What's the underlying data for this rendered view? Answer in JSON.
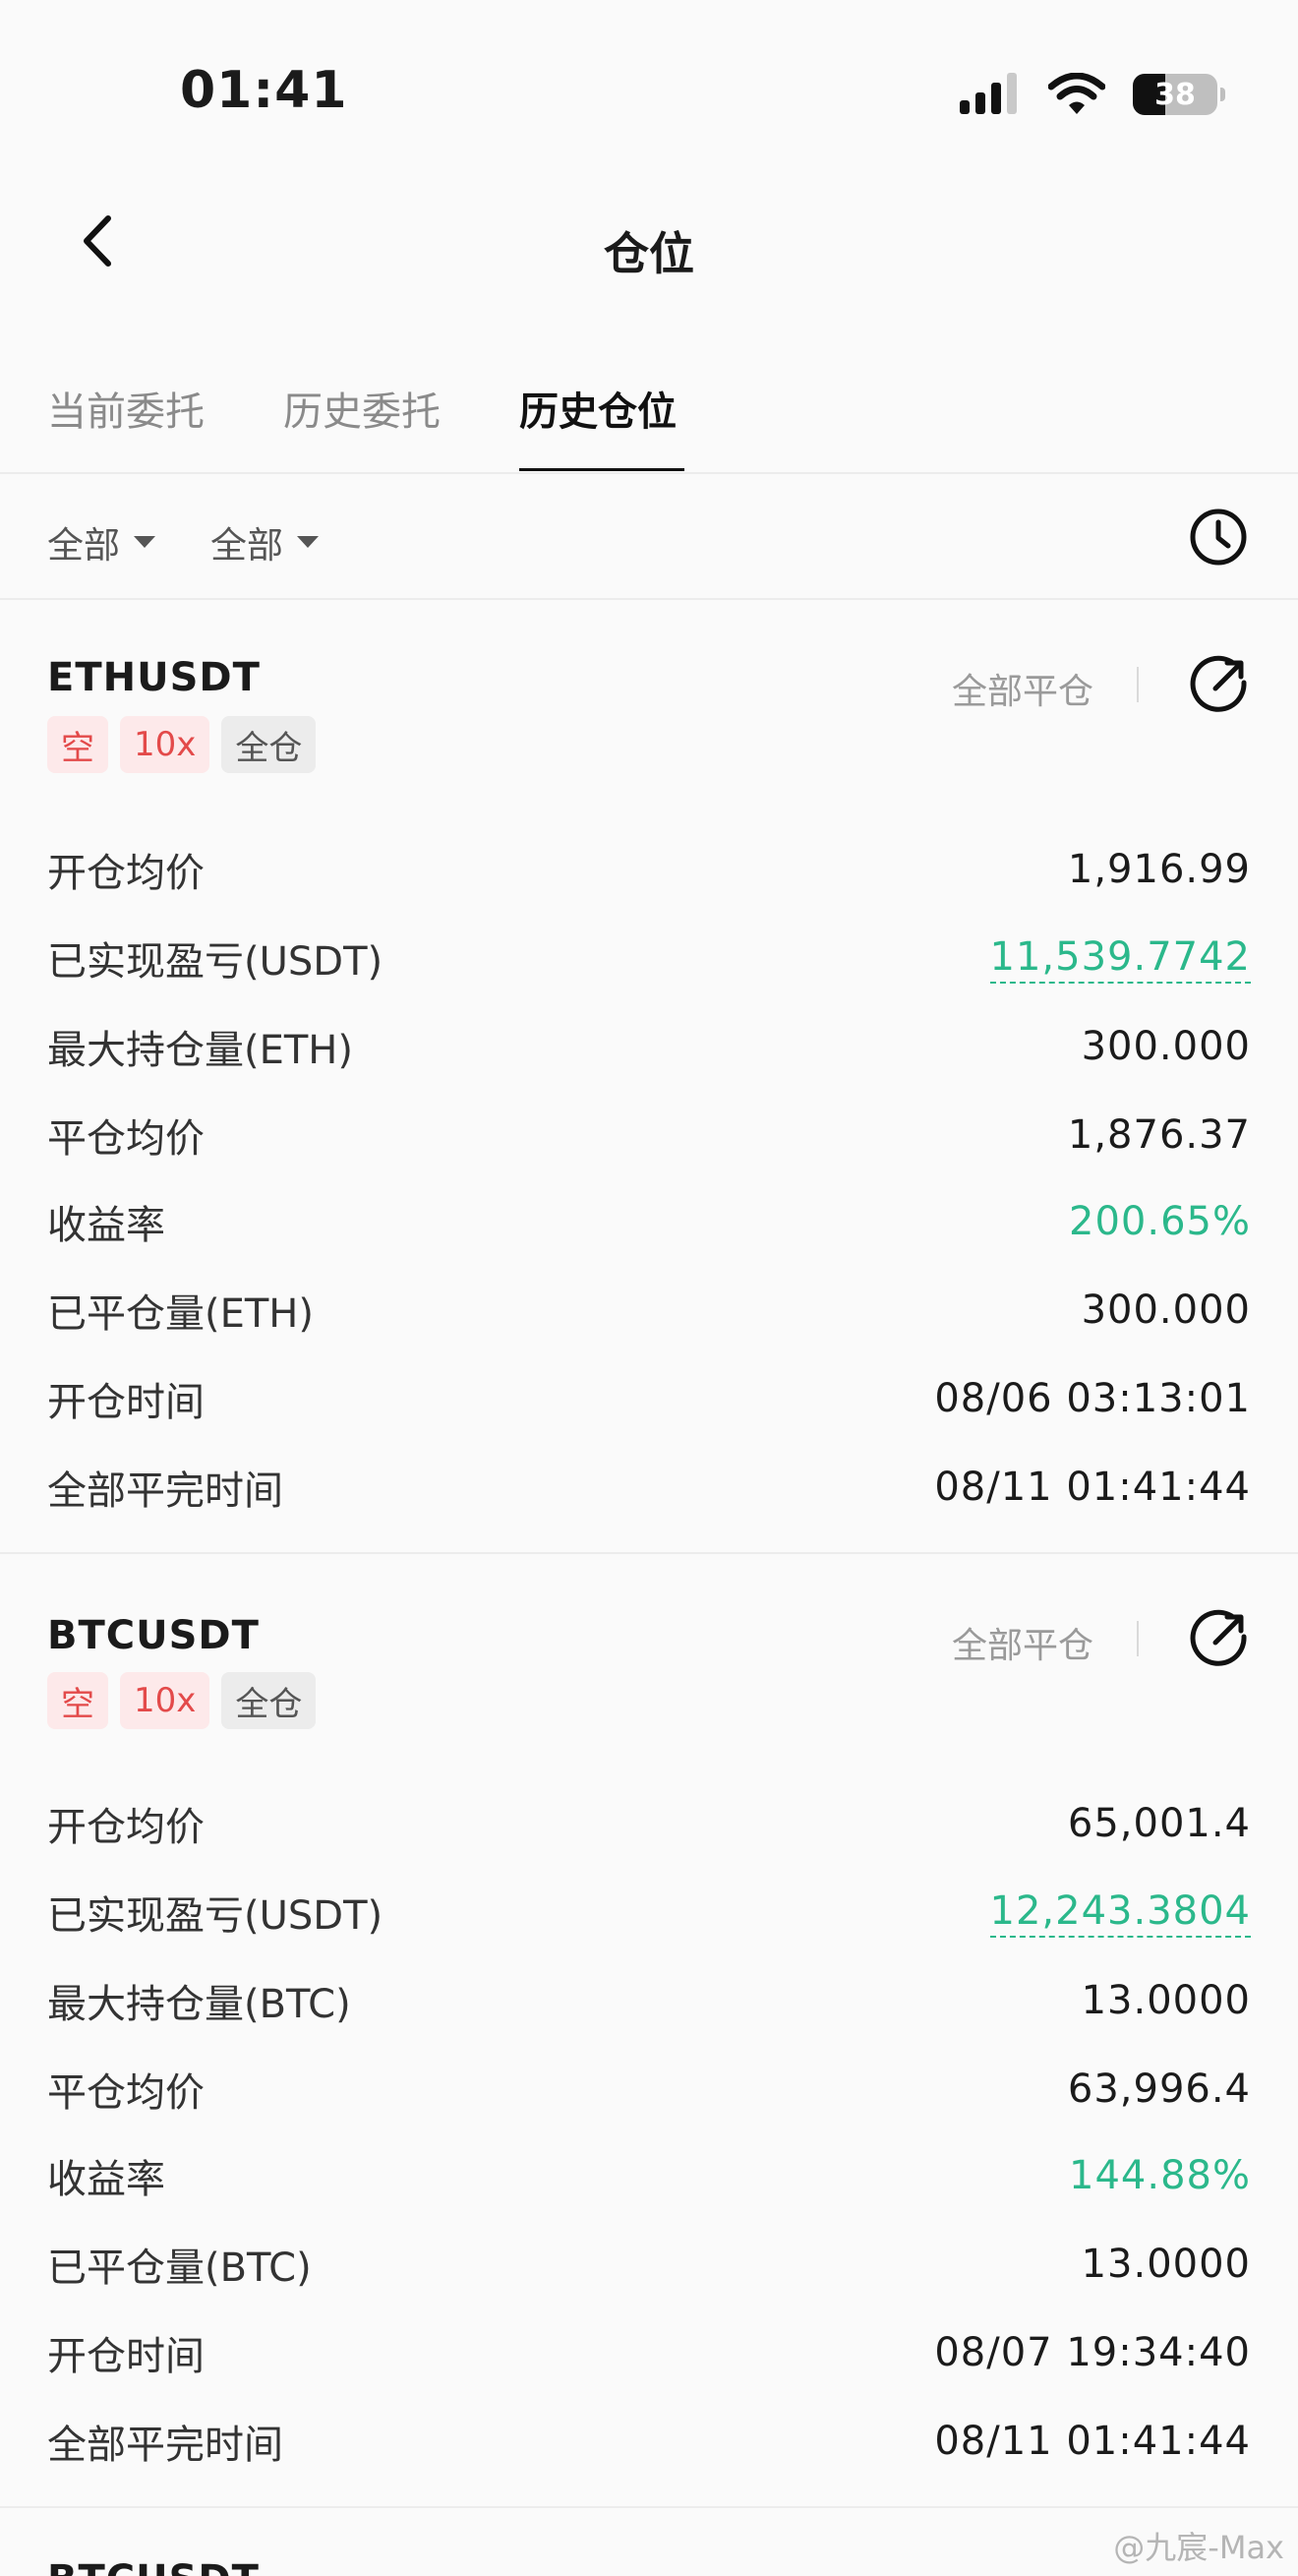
{
  "status_bar": {
    "time": "01:41",
    "battery": "38",
    "battery_level": 0.38
  },
  "header": {
    "title": "仓位"
  },
  "tabs": [
    {
      "label": "当前委托"
    },
    {
      "label": "历史委托"
    },
    {
      "label": "历史仓位"
    }
  ],
  "filters": [
    {
      "label": "全部"
    },
    {
      "label": "全部"
    }
  ],
  "cards": [
    {
      "symbol": "ETHUSDT",
      "close_all": "全部平仓",
      "tags": {
        "side": "空",
        "leverage": "10x",
        "mode": "全仓"
      },
      "rows": [
        {
          "label": "开仓均价",
          "value": "1,916.99"
        },
        {
          "label": "已实现盈亏(USDT)",
          "value": "11,539.7742"
        },
        {
          "label": "最大持仓量(ETH)",
          "value": "300.000"
        },
        {
          "label": "平仓均价",
          "value": "1,876.37"
        },
        {
          "label": "收益率",
          "value": "200.65%"
        },
        {
          "label": "已平仓量(ETH)",
          "value": "300.000"
        },
        {
          "label": "开仓时间",
          "value": "08/06 03:13:01"
        },
        {
          "label": "全部平完时间",
          "value": "08/11 01:41:44"
        }
      ]
    },
    {
      "symbol": "BTCUSDT",
      "close_all": "全部平仓",
      "tags": {
        "side": "空",
        "leverage": "10x",
        "mode": "全仓"
      },
      "rows": [
        {
          "label": "开仓均价",
          "value": "65,001.4"
        },
        {
          "label": "已实现盈亏(USDT)",
          "value": "12,243.3804"
        },
        {
          "label": "最大持仓量(BTC)",
          "value": "13.0000"
        },
        {
          "label": "平仓均价",
          "value": "63,996.4"
        },
        {
          "label": "收益率",
          "value": "144.88%"
        },
        {
          "label": "已平仓量(BTC)",
          "value": "13.0000"
        },
        {
          "label": "开仓时间",
          "value": "08/07 19:34:40"
        },
        {
          "label": "全部平完时间",
          "value": "08/11 01:41:44"
        }
      ]
    },
    {
      "symbol": "BTCUSDT"
    }
  ],
  "colors": {
    "profit_green": "#2bb88b",
    "short_red": "#e34a4a",
    "accent_black": "#111111"
  },
  "watermark": "@九宸-Max"
}
